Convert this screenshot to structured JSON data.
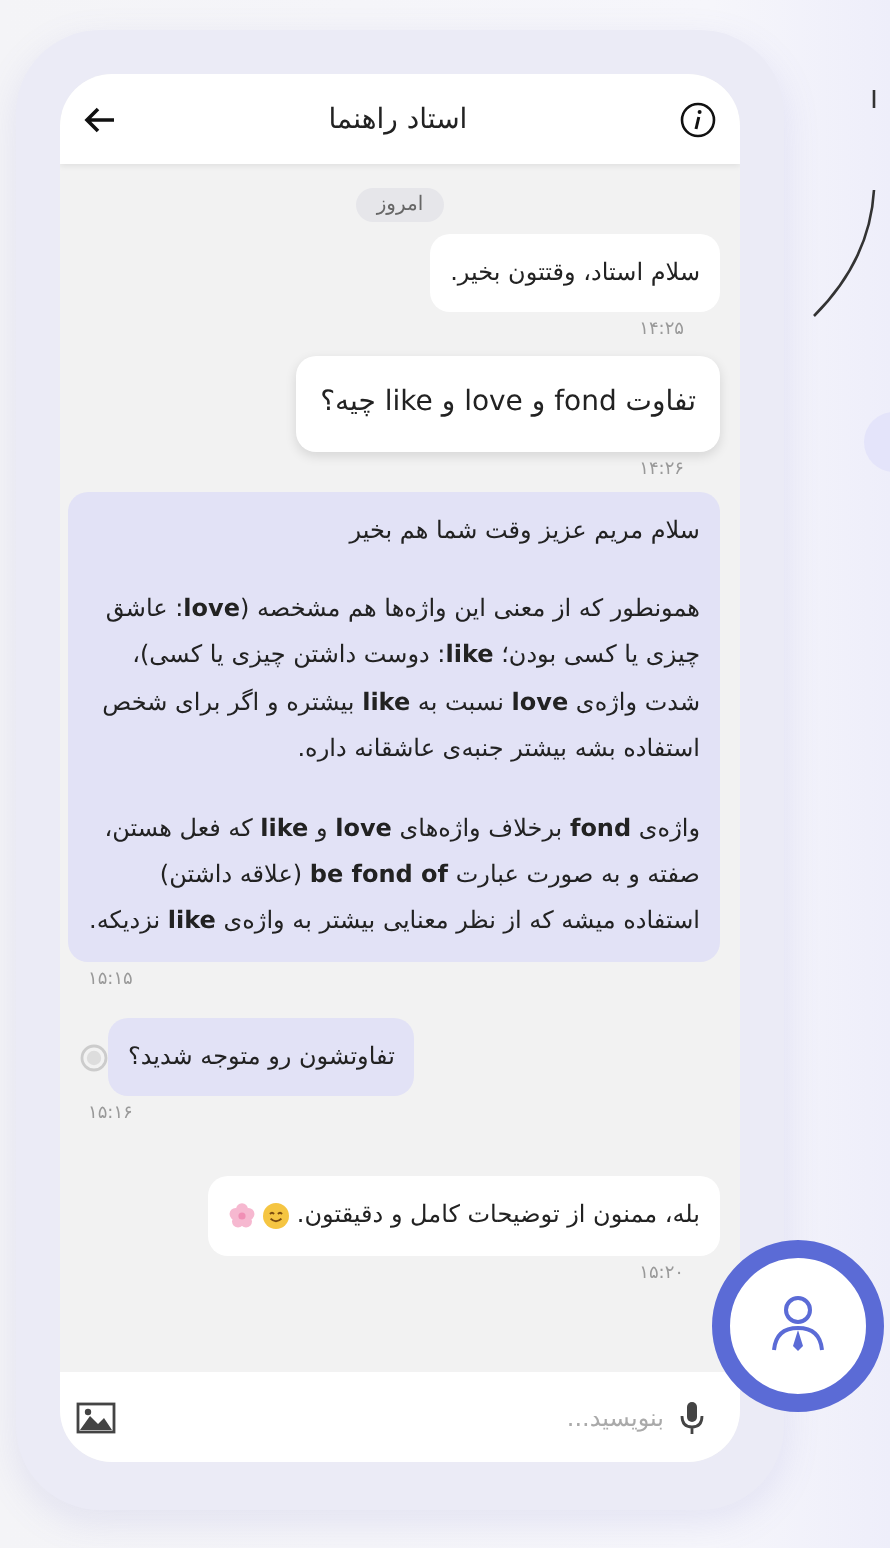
{
  "header": {
    "title": "استاد راهنما"
  },
  "date_chip": "امروز",
  "messages": [
    {
      "kind": "sent",
      "paragraphs": [
        "سلام استاد، وقتتون بخیر."
      ],
      "time": "۱۴:۲۵"
    },
    {
      "kind": "highlighted",
      "paragraphs": [
        "تفاوت fond و love و like چیه؟"
      ],
      "time": "۱۴:۲۶"
    },
    {
      "kind": "received",
      "paragraphs": [
        "سلام مریم عزیز وقت شما هم بخیر",
        "همونطور که از معنی این واژه‌ها هم مشخصه (**love**: عاشق چیزی یا کسی بودن؛ **like**: دوست داشتن چیزی یا کسی)، شدت واژه‌ی **love** نسبت به **like** بیشتره و اگر برای شخص استفاده بشه بیشتر جنبه‌ی عاشقانه داره.",
        "واژه‌ی **fond** برخلاف واژه‌های **love** و **like** که فعل هستن، صفته و به صورت عبارت **be fond of** (علاقه داشتن) استفاده میشه که از نظر معنایی بیشتر به واژه‌ی **like** نزدیکه."
      ],
      "time": "۱۵:۱۵"
    },
    {
      "kind": "received",
      "reaction_button": true,
      "paragraphs": [
        "تفاوتشون رو متوجه شدید؟"
      ],
      "time": "۱۵:۱۶"
    },
    {
      "kind": "sent",
      "trailing_icons": [
        {
          "kind": "smile"
        },
        {
          "kind": "flower"
        }
      ],
      "paragraphs": [
        "بله، ممنون از توضیحات کامل و دقیقتون."
      ],
      "time": "۱۵:۲۰"
    }
  ],
  "composer": {
    "placeholder": "بنویسید..."
  }
}
